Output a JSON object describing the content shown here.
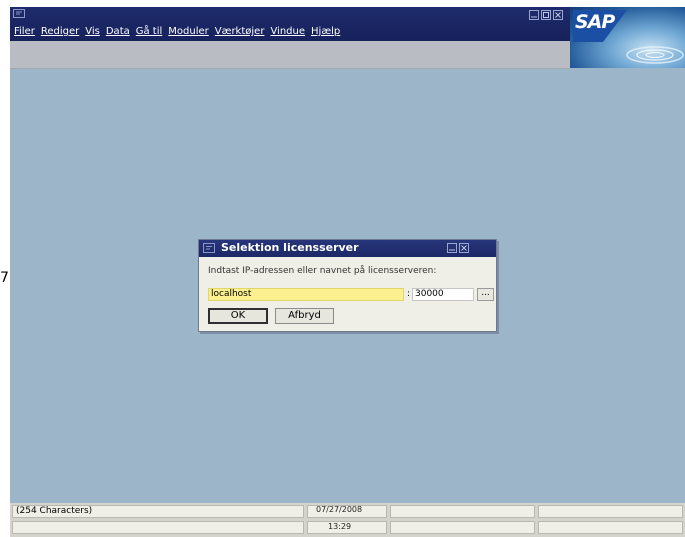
{
  "menu": {
    "items": [
      "Filer",
      "Rediger",
      "Vis",
      "Data",
      "Gå til",
      "Moduler",
      "Værktøjer",
      "Vindue",
      "Hjælp"
    ]
  },
  "brand": {
    "logo_text": "SAP"
  },
  "side_fragment": "7",
  "dialog": {
    "title": "Selektion licensserver",
    "prompt": "Indtast IP-adressen eller navnet på licensserveren:",
    "host_value": "localhost",
    "colon": ":",
    "port_value": "30000",
    "browse_label": "...",
    "ok_label": "OK",
    "cancel_label": "Afbryd"
  },
  "status": {
    "message": "(254 Characters)",
    "date": "07/27/2008",
    "time": "13:29"
  },
  "colors": {
    "title_bar": "#1c2866",
    "desktop": "#9db5c9",
    "host_field": "#fbf08f"
  }
}
